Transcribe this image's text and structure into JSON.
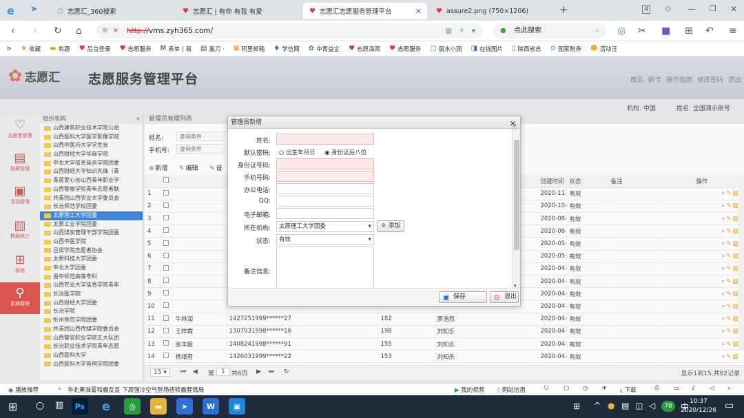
{
  "browser": {
    "tabs": [
      "志愿汇_360搜索",
      "志愿汇 | 有你 有我 有爱",
      "志愿汇志愿服务管理平台",
      "assure2.png (750×1206)"
    ],
    "url_prefix": "http://",
    "url": "vms.zyh365.com/",
    "search_placeholder": "点此搜索",
    "bookmarks": [
      "收藏",
      "有趣",
      "后台登录",
      "志愿服务",
      "表单 | 易",
      "墨刀 ·",
      "阿里邮箱",
      "学信网",
      "中青益企",
      "志愿海南",
      "志愿服务",
      "丽水小国",
      "在线图片",
      "陕西省志",
      "国家税务",
      "活动汪"
    ]
  },
  "app": {
    "logo_text": "志愿汇",
    "title": "志愿服务管理平台",
    "top_links": [
      "首页",
      "刷卡",
      "操作指南",
      "修改密码",
      "退出"
    ],
    "org_label": "机构:",
    "org_value": "中国",
    "name_label": "姓名:",
    "name_value": "全国演示账号"
  },
  "leftnav": [
    "志愿者管理",
    "档案管理",
    "活动管理",
    "数据统计",
    "其他",
    "系统管理"
  ],
  "tree": {
    "title": "组织机构",
    "items": [
      "山西建筑职业技术学院公益",
      "山西医科大学医学影像学院",
      "山西中医药大学学生会",
      "山西财经大学华商学院",
      "中北大学信息商务学院团委",
      "山西财经大学知识先锋（青",
      "青蓝爱心会山西青年职业学",
      "山西警察学院青年志愿者联",
      "共青团山西农业大学委员会",
      "长治师范学校团委",
      "太原理工大学团委",
      "太原工业学院团委",
      "山西煤炭管理干部学院团委",
      "山西中医学院",
      "吕梁学院志愿者协会",
      "太原科技大学团委",
      "中北大学团委",
      "晋中师范高等专科",
      "山西农业大学信息学院青年",
      "长治医学院",
      "山西财经大学团委",
      "长治学院",
      "忻州师范学院团委",
      "共青团山西传媒学院委员会",
      "山西警官职业学院五大队团",
      "长治职业技术学院青年志愿",
      "山西医科大学",
      "山西医科大学晋祠学院团委"
    ]
  },
  "main": {
    "panel_title": "管理员管理列表",
    "name_label": "姓名:",
    "name_placeholder": "查询条件",
    "phone_label": "手机号:",
    "phone_placeholder": "查询条件",
    "add_label": "新增",
    "edit_label": "编辑",
    "set_label": "设",
    "columns": [
      "创建时间",
      "状态",
      "备注",
      "操作"
    ],
    "rows": [
      {
        "no": "1",
        "name": "",
        "id": "",
        "num": "",
        "pub": "",
        "time": "2020-11-18 20:44:14",
        "status": "有效"
      },
      {
        "no": "2",
        "name": "",
        "id": "",
        "num": "",
        "pub": "",
        "time": "2020-10-14 12:30:39",
        "status": "有效"
      },
      {
        "no": "3",
        "name": "",
        "id": "",
        "num": "",
        "pub": "",
        "time": "2020-08-17 23:25:59",
        "status": "有效"
      },
      {
        "no": "4",
        "name": "",
        "id": "",
        "num": "",
        "pub": "",
        "time": "2020-06-24 17:08:32",
        "status": "有效"
      },
      {
        "no": "5",
        "name": "",
        "id": "",
        "num": "",
        "pub": "",
        "time": "2020-05-25 15:43:58",
        "status": "有效"
      },
      {
        "no": "6",
        "name": "",
        "id": "",
        "num": "",
        "pub": "",
        "time": "2020-05-22 17:53:02",
        "status": "有效"
      },
      {
        "no": "7",
        "name": "",
        "id": "",
        "num": "",
        "pub": "",
        "time": "2020-04-29 15:28:52",
        "status": "有效"
      },
      {
        "no": "8",
        "name": "",
        "id": "",
        "num": "",
        "pub": "",
        "time": "2020-04-24 20:07:42",
        "status": "有效"
      },
      {
        "no": "9",
        "name": "",
        "id": "",
        "num": "",
        "pub": "",
        "time": "2020-04-24 18:00:49",
        "status": "有效"
      },
      {
        "no": "10",
        "name": "",
        "id": "",
        "num": "",
        "pub": "",
        "time": "2020-04-23 15:19:01",
        "status": "有效"
      },
      {
        "no": "11",
        "name": "牛林润",
        "id": "1427251999******27",
        "num": "182",
        "pub": "贾浩然",
        "time": "2020-04-23 14:47:22",
        "status": "有效"
      },
      {
        "no": "12",
        "name": "王梓霖",
        "id": "1307031998******16",
        "num": "198",
        "pub": "刘知乐",
        "time": "2020-04-16 23:43:41",
        "status": "有效"
      },
      {
        "no": "13",
        "name": "张丰毅",
        "id": "1408241998******91",
        "num": "155",
        "pub": "刘知乐",
        "time": "2020-04-16 23:43:03",
        "status": "有效"
      },
      {
        "no": "14",
        "name": "杨靖君",
        "id": "1426031999******22",
        "num": "153",
        "pub": "刘知乐",
        "time": "2020-04-16 23:42:17",
        "status": "有效"
      }
    ],
    "pager": {
      "size": "15",
      "page_label": "第",
      "page": "1",
      "total_pages": "共6页",
      "summary": "显示1到15,共82记录"
    }
  },
  "dialog": {
    "title": "管理员新增",
    "name_label": "姓名:",
    "pwd_label": "默认密码:",
    "pwd_opt1": "出生年月日",
    "pwd_opt2": "身份证后八位",
    "idcard_label": "身份证号码:",
    "phone_label": "手机号码:",
    "office_label": "办公电话:",
    "qq_label": "QQ:",
    "email_label": "电子邮箱:",
    "org_label": "所在机构:",
    "org_value": "太原理工大学团委",
    "add_org": "添加",
    "status_label": "状态:",
    "status_value": "有效",
    "remark_label": "备注信息:",
    "save_label": "保存",
    "exit_label": "退出"
  },
  "statusbar": {
    "left": "播放推荐",
    "news": "华北黄淮雾和霾反复 下周强冷空气登场扭转霾腥情局",
    "video": "我的视频",
    "credit": "网站信用",
    "download": "下载"
  },
  "taskbar": {
    "time": "10:37",
    "date": "2020/12/26",
    "badge": "78"
  }
}
